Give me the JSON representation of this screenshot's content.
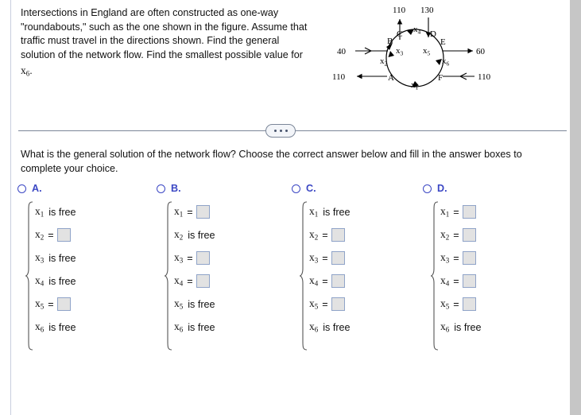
{
  "problem": {
    "text": "Intersections in England are often constructed as one-way \"roundabouts,\" such as the one shown in the figure. Assume that traffic must travel in the directions shown. Find the general solution of the network flow. Find the smallest possible value for",
    "trailing_variable": "x",
    "trailing_subscript": "6",
    "trailing_period": "."
  },
  "figure": {
    "name": "roundabout-network-diagram",
    "nodes": [
      "A",
      "B",
      "C",
      "D",
      "E",
      "F"
    ],
    "edge_labels": [
      "x1",
      "x2",
      "x3",
      "x4",
      "x5",
      "x6"
    ],
    "external_flows": [
      {
        "label": "110",
        "position": "top-left-out",
        "direction": "out"
      },
      {
        "label": "130",
        "position": "top-right-in",
        "direction": "in"
      },
      {
        "label": "40",
        "position": "left-upper-in",
        "direction": "in"
      },
      {
        "label": "110",
        "position": "left-lower-out",
        "direction": "out"
      },
      {
        "label": "60",
        "position": "right-upper-out",
        "direction": "out"
      },
      {
        "label": "110",
        "position": "right-lower-in",
        "direction": "in"
      }
    ]
  },
  "divider": {
    "dots_label": "more-options"
  },
  "question": {
    "text": "What is the general solution of the network flow? Choose the correct answer below and fill in the answer boxes to complete your choice."
  },
  "choices": [
    {
      "letter": "A.",
      "rows": [
        {
          "var": "x",
          "sub": "1",
          "kind": "free",
          "free_text": "is free"
        },
        {
          "var": "x",
          "sub": "2",
          "kind": "box",
          "eq": "=",
          "value": ""
        },
        {
          "var": "x",
          "sub": "3",
          "kind": "free",
          "free_text": "is free"
        },
        {
          "var": "x",
          "sub": "4",
          "kind": "free",
          "free_text": "is free"
        },
        {
          "var": "x",
          "sub": "5",
          "kind": "box",
          "eq": "=",
          "value": ""
        },
        {
          "var": "x",
          "sub": "6",
          "kind": "free",
          "free_text": "is free"
        }
      ]
    },
    {
      "letter": "B.",
      "rows": [
        {
          "var": "x",
          "sub": "1",
          "kind": "box",
          "eq": "=",
          "value": ""
        },
        {
          "var": "x",
          "sub": "2",
          "kind": "free",
          "free_text": "is free"
        },
        {
          "var": "x",
          "sub": "3",
          "kind": "box",
          "eq": "=",
          "value": ""
        },
        {
          "var": "x",
          "sub": "4",
          "kind": "box",
          "eq": "=",
          "value": ""
        },
        {
          "var": "x",
          "sub": "5",
          "kind": "free",
          "free_text": "is free"
        },
        {
          "var": "x",
          "sub": "6",
          "kind": "free",
          "free_text": "is free"
        }
      ]
    },
    {
      "letter": "C.",
      "rows": [
        {
          "var": "x",
          "sub": "1",
          "kind": "free",
          "free_text": "is free"
        },
        {
          "var": "x",
          "sub": "2",
          "kind": "box",
          "eq": "=",
          "value": ""
        },
        {
          "var": "x",
          "sub": "3",
          "kind": "box",
          "eq": "=",
          "value": ""
        },
        {
          "var": "x",
          "sub": "4",
          "kind": "box",
          "eq": "=",
          "value": ""
        },
        {
          "var": "x",
          "sub": "5",
          "kind": "box",
          "eq": "=",
          "value": ""
        },
        {
          "var": "x",
          "sub": "6",
          "kind": "free",
          "free_text": "is free"
        }
      ]
    },
    {
      "letter": "D.",
      "rows": [
        {
          "var": "x",
          "sub": "1",
          "kind": "box",
          "eq": "=",
          "value": ""
        },
        {
          "var": "x",
          "sub": "2",
          "kind": "box",
          "eq": "=",
          "value": ""
        },
        {
          "var": "x",
          "sub": "3",
          "kind": "box",
          "eq": "=",
          "value": ""
        },
        {
          "var": "x",
          "sub": "4",
          "kind": "box",
          "eq": "=",
          "value": ""
        },
        {
          "var": "x",
          "sub": "5",
          "kind": "box",
          "eq": "=",
          "value": ""
        },
        {
          "var": "x",
          "sub": "6",
          "kind": "free",
          "free_text": "is free"
        }
      ]
    }
  ],
  "colors": {
    "choice_accent": "#3b47c4",
    "answer_box_fill": "#e2e2e2",
    "answer_box_border": "#8fa3c8",
    "divider": "#7b8698",
    "gutter": "#c6c6c6"
  }
}
